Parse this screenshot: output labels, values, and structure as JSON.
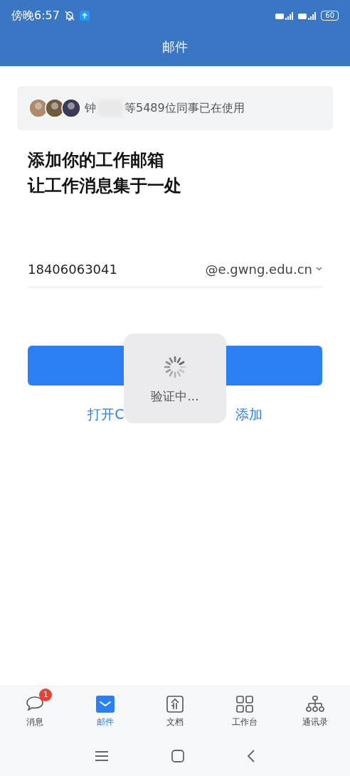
{
  "status_bar": {
    "time": "傍晚6:57",
    "battery": "60"
  },
  "header": {
    "title": "邮件"
  },
  "colleagues": {
    "name_start": "钟",
    "text": "等5489位同事已在使用"
  },
  "heading": {
    "lines": [
      "添加你的工作邮箱",
      "让工作消息集于一处"
    ]
  },
  "email": {
    "value": "18406063041",
    "domain": "@e.gwng.edu.cn"
  },
  "link": {
    "before": "打开C",
    "after": "添加"
  },
  "loading": {
    "text": "验证中..."
  },
  "tabs": [
    {
      "label": "消息",
      "kind": "chat",
      "selected": false,
      "badge": "1"
    },
    {
      "label": "邮件",
      "kind": "mail",
      "selected": true
    },
    {
      "label": "文档",
      "kind": "doc",
      "selected": false
    },
    {
      "label": "工作台",
      "kind": "grid",
      "selected": false
    },
    {
      "label": "通讯录",
      "kind": "org",
      "selected": false
    }
  ]
}
